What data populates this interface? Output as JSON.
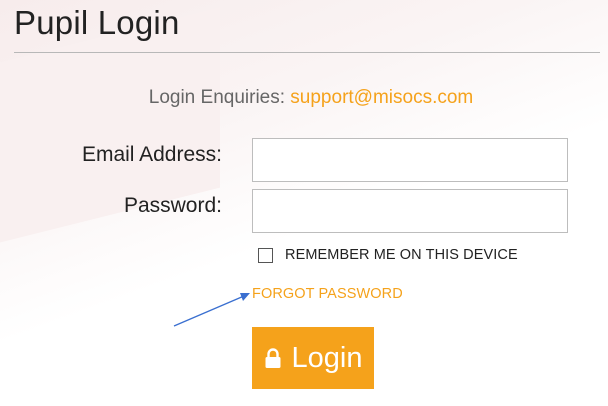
{
  "page": {
    "title": "Pupil Login"
  },
  "enquiries": {
    "label": "Login Enquiries:",
    "email": "support@misocs.com"
  },
  "form": {
    "email_label": "Email Address:",
    "email_value": "",
    "password_label": "Password:",
    "password_value": "",
    "remember_label": "REMEMBER ME ON THIS DEVICE",
    "remember_checked": false,
    "forgot_label": "FORGOT PASSWORD",
    "login_label": "Login"
  },
  "icons": {
    "login_button_icon": "lock-icon",
    "annotation": "arrow-icon"
  },
  "colors": {
    "accent": "#f5a21b",
    "annotation_arrow": "#3a6fd0",
    "divider": "#b8b8b8"
  }
}
